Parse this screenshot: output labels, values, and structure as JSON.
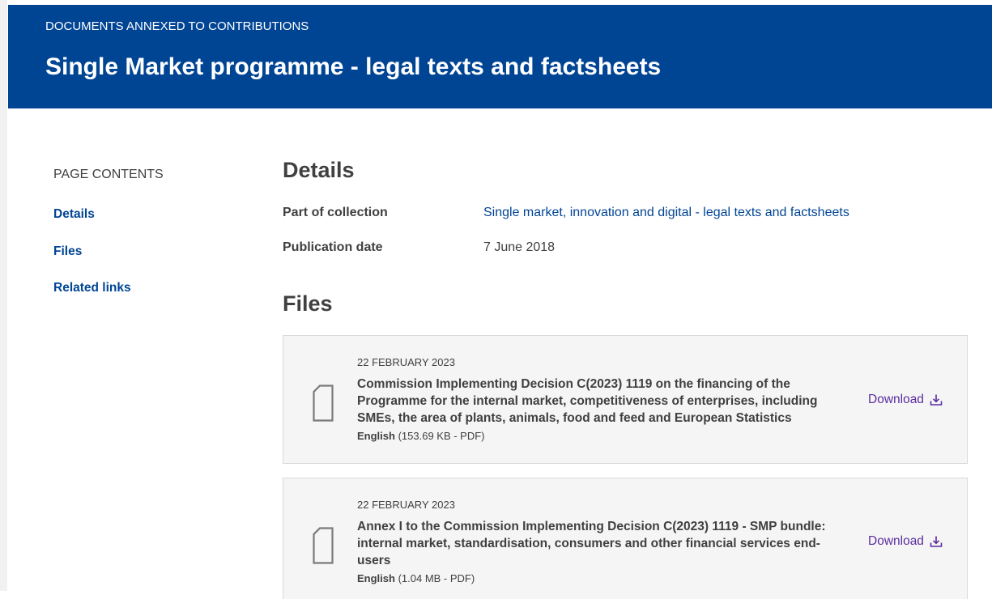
{
  "banner": {
    "kicker": "DOCUMENTS ANNEXED TO CONTRIBUTIONS",
    "title": "Single Market programme - legal texts and factsheets"
  },
  "sidebar": {
    "title": "PAGE CONTENTS",
    "links": [
      "Details",
      "Files",
      "Related links"
    ]
  },
  "details": {
    "heading": "Details",
    "collection_label": "Part of collection",
    "collection_value": "Single market, innovation and digital - legal texts and factsheets",
    "pubdate_label": "Publication date",
    "pubdate_value": "7 June 2018"
  },
  "files": {
    "heading": "Files",
    "items": [
      {
        "date": "22 FEBRUARY 2023",
        "title": "Commission Implementing Decision C(2023) 1119 on the financing of the Programme for the internal market, competitiveness of enterprises, including SMEs, the area of plants, animals, food and feed and European Statistics",
        "language": "English",
        "size": "(153.69 KB - PDF)",
        "download_label": "Download"
      },
      {
        "date": "22 FEBRUARY 2023",
        "title": "Annex I to the Commission Implementing Decision C(2023) 1119 - SMP bundle: internal market, standardisation, consumers and other financial services end-users",
        "language": "English",
        "size": "(1.04 MB - PDF)",
        "download_label": "Download"
      }
    ]
  },
  "colors": {
    "banner": "#004494",
    "link": "#004494",
    "download": "#5a2da0",
    "card": "#f5f5f5"
  }
}
